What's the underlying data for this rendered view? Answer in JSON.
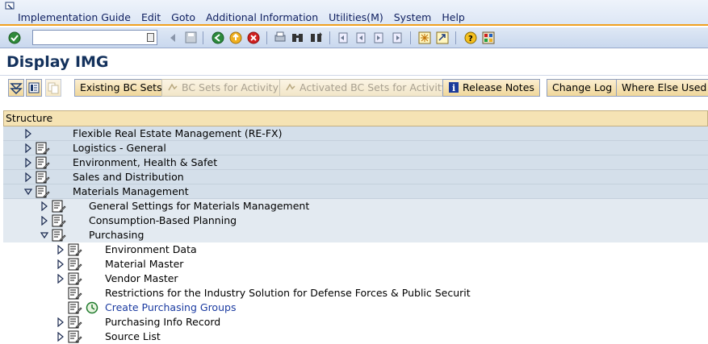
{
  "menu": {
    "items": [
      "Implementation Guide",
      "Edit",
      "Goto",
      "Additional Information",
      "Utilities(M)",
      "System",
      "Help"
    ]
  },
  "toolbar": {
    "command_field_value": "",
    "icons": [
      "enter-icon",
      "back-icon",
      "save-icon",
      "back-green-icon",
      "exit-icon",
      "cancel-icon",
      "print-icon",
      "find-icon",
      "find-next-icon",
      "first-page-icon",
      "previous-page-icon",
      "next-page-icon",
      "last-page-icon",
      "create-session-icon",
      "shortcut-icon",
      "help-icon",
      "layout-icon"
    ]
  },
  "title": "Display IMG",
  "app_toolbar": {
    "existing_bc_sets": "Existing BC Sets",
    "bc_sets_for_activity": "BC Sets for Activity",
    "activated_bc_sets": "Activated BC Sets for Activity",
    "release_notes": "Release Notes",
    "change_log": "Change Log",
    "where_else_used": "Where Else Used"
  },
  "tree": {
    "header": "Structure",
    "rows": [
      {
        "label": "Flexible Real Estate Management (RE-FX)",
        "level": 0,
        "state": "collapsed",
        "doc": false
      },
      {
        "label": "Logistics - General",
        "level": 0,
        "state": "collapsed",
        "doc": true
      },
      {
        "label": "Environment, Health & Safet",
        "level": 0,
        "state": "collapsed",
        "doc": true
      },
      {
        "label": "Sales and Distribution",
        "level": 0,
        "state": "collapsed",
        "doc": true
      },
      {
        "label": "Materials Management",
        "level": 0,
        "state": "expanded",
        "doc": true
      },
      {
        "label": "General Settings for Materials Management",
        "level": 1,
        "state": "collapsed",
        "doc": true
      },
      {
        "label": "Consumption-Based Planning",
        "level": 1,
        "state": "collapsed",
        "doc": true
      },
      {
        "label": "Purchasing",
        "level": 1,
        "state": "expanded",
        "doc": true
      },
      {
        "label": "Environment Data",
        "level": 2,
        "state": "collapsed",
        "doc": true
      },
      {
        "label": "Material Master",
        "level": 2,
        "state": "collapsed",
        "doc": true
      },
      {
        "label": "Vendor Master",
        "level": 2,
        "state": "collapsed",
        "doc": true
      },
      {
        "label": "Restrictions for the Industry Solution for Defense Forces & Public Securit",
        "level": 2,
        "state": "leaf",
        "doc": true
      },
      {
        "label": "Create Purchasing Groups",
        "level": 2,
        "state": "leaf",
        "doc": true,
        "activity": true
      },
      {
        "label": "Purchasing Info Record",
        "level": 2,
        "state": "collapsed",
        "doc": true
      },
      {
        "label": "Source List",
        "level": 2,
        "state": "collapsed",
        "doc": true
      }
    ]
  }
}
